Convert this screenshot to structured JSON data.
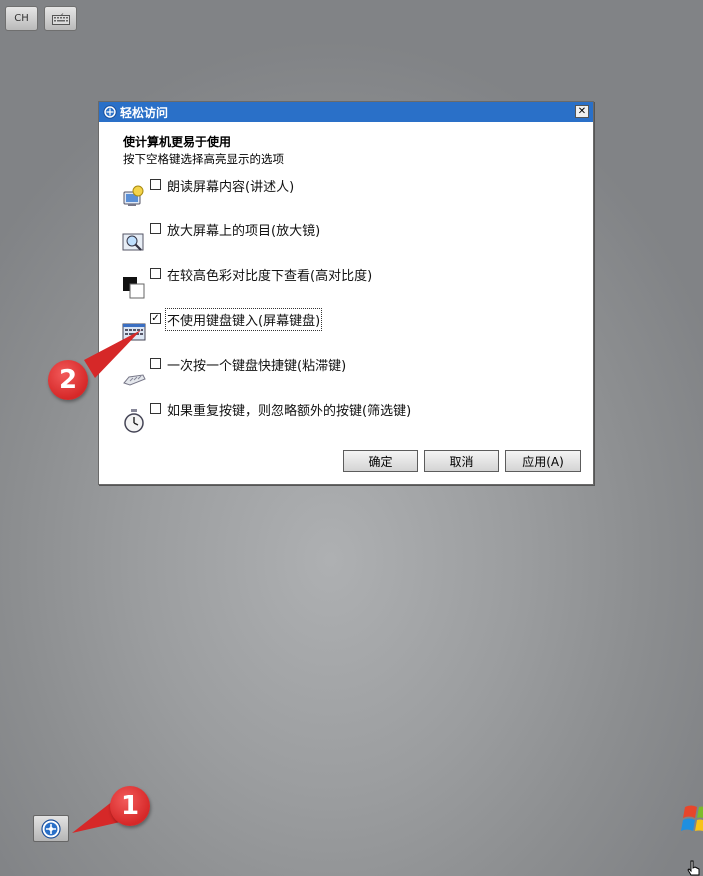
{
  "top_buttons": {
    "ime_label": "CH",
    "keyboard_icon": "keyboard-icon"
  },
  "dialog": {
    "title": "轻松访问",
    "close_label": "✕",
    "heading": "使计算机更易于使用",
    "subheading": "按下空格键选择高亮显示的选项",
    "options": [
      {
        "label": "朗读屏幕内容(讲述人)",
        "checked": false,
        "icon": "narrator-icon"
      },
      {
        "label": "放大屏幕上的项目(放大镜)",
        "checked": false,
        "icon": "magnifier-icon"
      },
      {
        "label": "在较高色彩对比度下查看(高对比度)",
        "checked": false,
        "icon": "high-contrast-icon"
      },
      {
        "label": "不使用键盘键入(屏幕键盘)",
        "checked": true,
        "icon": "on-screen-keyboard-icon"
      },
      {
        "label": "一次按一个键盘快捷键(粘滞键)",
        "checked": false,
        "icon": "sticky-keys-icon"
      },
      {
        "label": "如果重复按键，则忽略额外的按键(筛选键)",
        "checked": false,
        "icon": "filter-keys-icon"
      }
    ],
    "checkbox_checked_glyph": "✓",
    "buttons": {
      "ok": "确定",
      "cancel": "取消",
      "apply": "应用(A)"
    }
  },
  "annotations": {
    "badge_1": "1",
    "badge_2": "2",
    "badge_color": "#d62828"
  },
  "ease_of_access_button": {
    "icon": "ease-of-access-icon"
  },
  "colors": {
    "titlebar": "#2a70c8",
    "desktop": "#9b9d9f"
  }
}
